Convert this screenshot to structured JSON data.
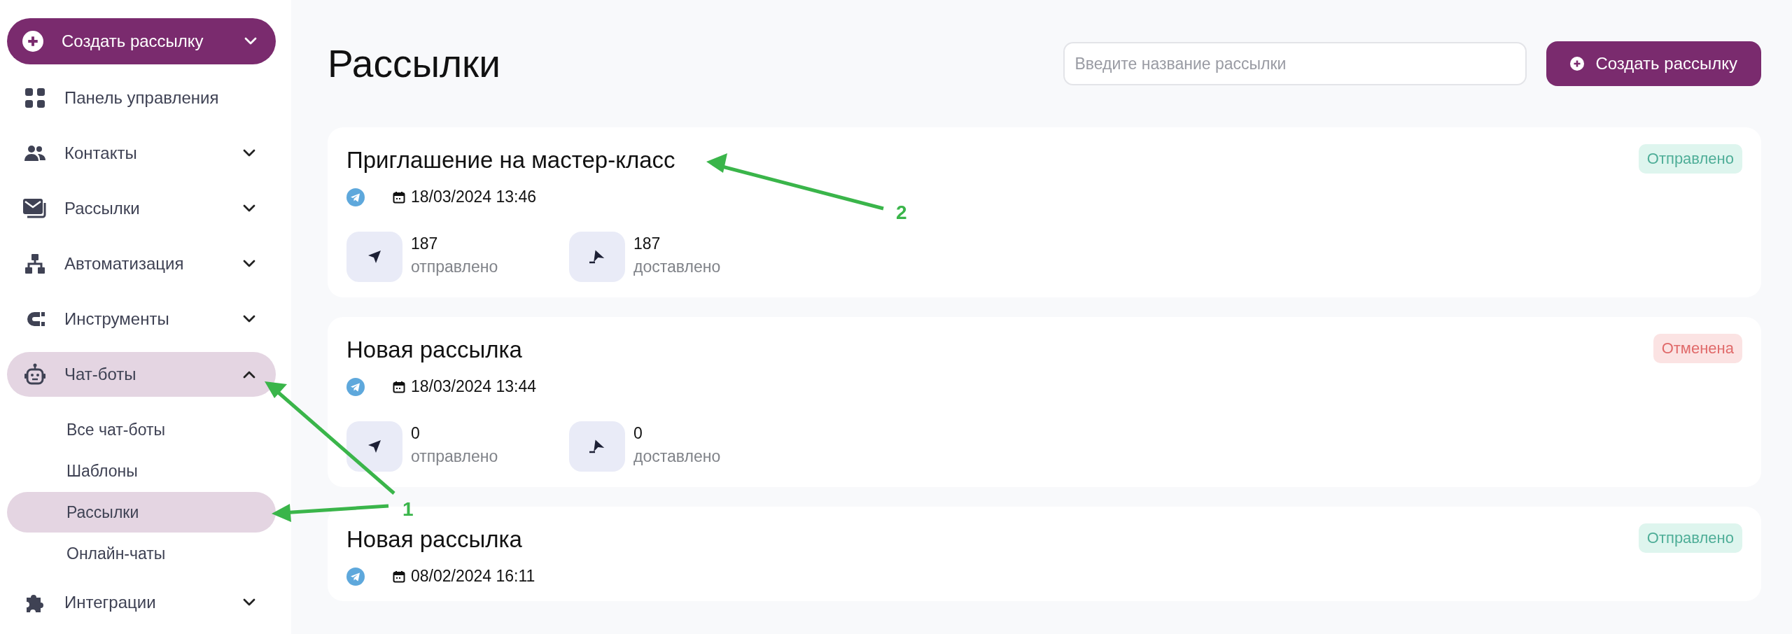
{
  "sidebar": {
    "create_button": {
      "label": "Создать рассылку"
    },
    "items": [
      {
        "label": "Панель управления",
        "kind": "link",
        "selected": false
      },
      {
        "label": "Контакты",
        "kind": "group",
        "expanded": false,
        "selected": false
      },
      {
        "label": "Рассылки",
        "kind": "group",
        "expanded": false,
        "selected": false
      },
      {
        "label": "Автоматизация",
        "kind": "group",
        "expanded": false,
        "selected": false
      },
      {
        "label": "Инструменты",
        "kind": "group",
        "expanded": false,
        "selected": false
      },
      {
        "label": "Чат-боты",
        "kind": "group",
        "expanded": true,
        "selected": true,
        "children": [
          {
            "label": "Все чат-боты",
            "selected": false
          },
          {
            "label": "Шаблоны",
            "selected": false
          },
          {
            "label": "Рассылки",
            "selected": true
          },
          {
            "label": "Онлайн-чаты",
            "selected": false
          }
        ]
      },
      {
        "label": "Интеграции",
        "kind": "group",
        "expanded": false,
        "selected": false
      }
    ]
  },
  "header": {
    "title": "Рассылки",
    "search": {
      "placeholder": "Введите название рассылки"
    },
    "create_button": {
      "label": "Создать рассылку"
    }
  },
  "mailings": [
    {
      "title": "Приглашение на мастер-класс",
      "date": "18/03/2024 13:46",
      "status": {
        "label": "Отправлено",
        "kind": "sent"
      },
      "stats": [
        {
          "value": "187",
          "label": "отправлено",
          "kind": "sent"
        },
        {
          "value": "187",
          "label": "доставлено",
          "kind": "delivered"
        }
      ]
    },
    {
      "title": "Новая рассылка",
      "date": "18/03/2024 13:44",
      "status": {
        "label": "Отменена",
        "kind": "cancelled"
      },
      "stats": [
        {
          "value": "0",
          "label": "отправлено",
          "kind": "sent"
        },
        {
          "value": "0",
          "label": "доставлено",
          "kind": "delivered"
        }
      ]
    },
    {
      "title": "Новая рассылка",
      "date": "08/02/2024 16:11",
      "status": {
        "label": "Отправлено",
        "kind": "sent"
      }
    }
  ],
  "annotations": [
    {
      "label": "1"
    },
    {
      "label": "2"
    }
  ]
}
